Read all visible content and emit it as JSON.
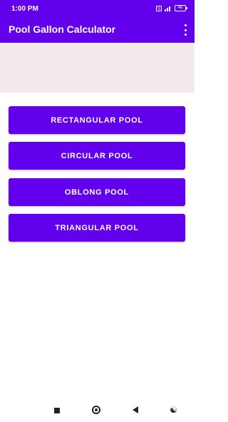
{
  "status_bar": {
    "time": "1:00 PM",
    "sim_label": "S",
    "battery_label": "46"
  },
  "app_bar": {
    "title": "Pool Gallon Calculator",
    "overflow_icon": "more-vert-icon"
  },
  "buttons": [
    {
      "label": "RECTANGULAR POOL"
    },
    {
      "label": "CIRCULAR POOL"
    },
    {
      "label": "OBLONG POOL"
    },
    {
      "label": "TRIANGULAR POOL"
    }
  ],
  "nav_bar": {
    "recent_icon": "square-recent-icon",
    "home_icon": "circle-home-icon",
    "back_icon": "triangle-back-icon",
    "accessibility_icon": "accessibility-icon"
  },
  "colors": {
    "primary": "#6200ee",
    "banner_background": "#f3eaec"
  }
}
